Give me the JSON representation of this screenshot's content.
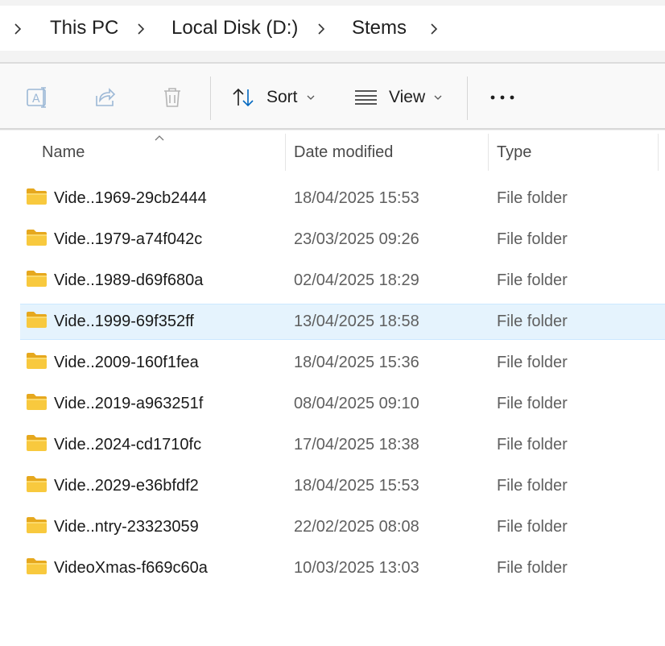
{
  "breadcrumb": {
    "items": [
      "This PC",
      "Local Disk (D:)",
      "Stems"
    ]
  },
  "toolbar": {
    "icons": [
      "rename-icon",
      "share-icon",
      "delete-icon"
    ],
    "sort_label": "Sort",
    "view_label": "View",
    "more_label": "•••"
  },
  "columns": {
    "name": "Name",
    "date": "Date modified",
    "type": "Type"
  },
  "selected_row": 3,
  "colors": {
    "selection_bg": "#e5f3fd",
    "folder_yellow": "#f8c93e",
    "accent": "#0067c0"
  },
  "files": [
    {
      "name": "Vide..1969-29cb2444",
      "date": "18/04/2025 15:53",
      "type": "File folder"
    },
    {
      "name": "Vide..1979-a74f042c",
      "date": "23/03/2025 09:26",
      "type": "File folder"
    },
    {
      "name": "Vide..1989-d69f680a",
      "date": "02/04/2025 18:29",
      "type": "File folder"
    },
    {
      "name": "Vide..1999-69f352ff",
      "date": "13/04/2025 18:58",
      "type": "File folder"
    },
    {
      "name": "Vide..2009-160f1fea",
      "date": "18/04/2025 15:36",
      "type": "File folder"
    },
    {
      "name": "Vide..2019-a963251f",
      "date": "08/04/2025 09:10",
      "type": "File folder"
    },
    {
      "name": "Vide..2024-cd1710fc",
      "date": "17/04/2025 18:38",
      "type": "File folder"
    },
    {
      "name": "Vide..2029-e36bfdf2",
      "date": "18/04/2025 15:53",
      "type": "File folder"
    },
    {
      "name": "Vide..ntry-23323059",
      "date": "22/02/2025 08:08",
      "type": "File folder"
    },
    {
      "name": "VideoXmas-f669c60a",
      "date": "10/03/2025 13:03",
      "type": "File folder"
    }
  ]
}
